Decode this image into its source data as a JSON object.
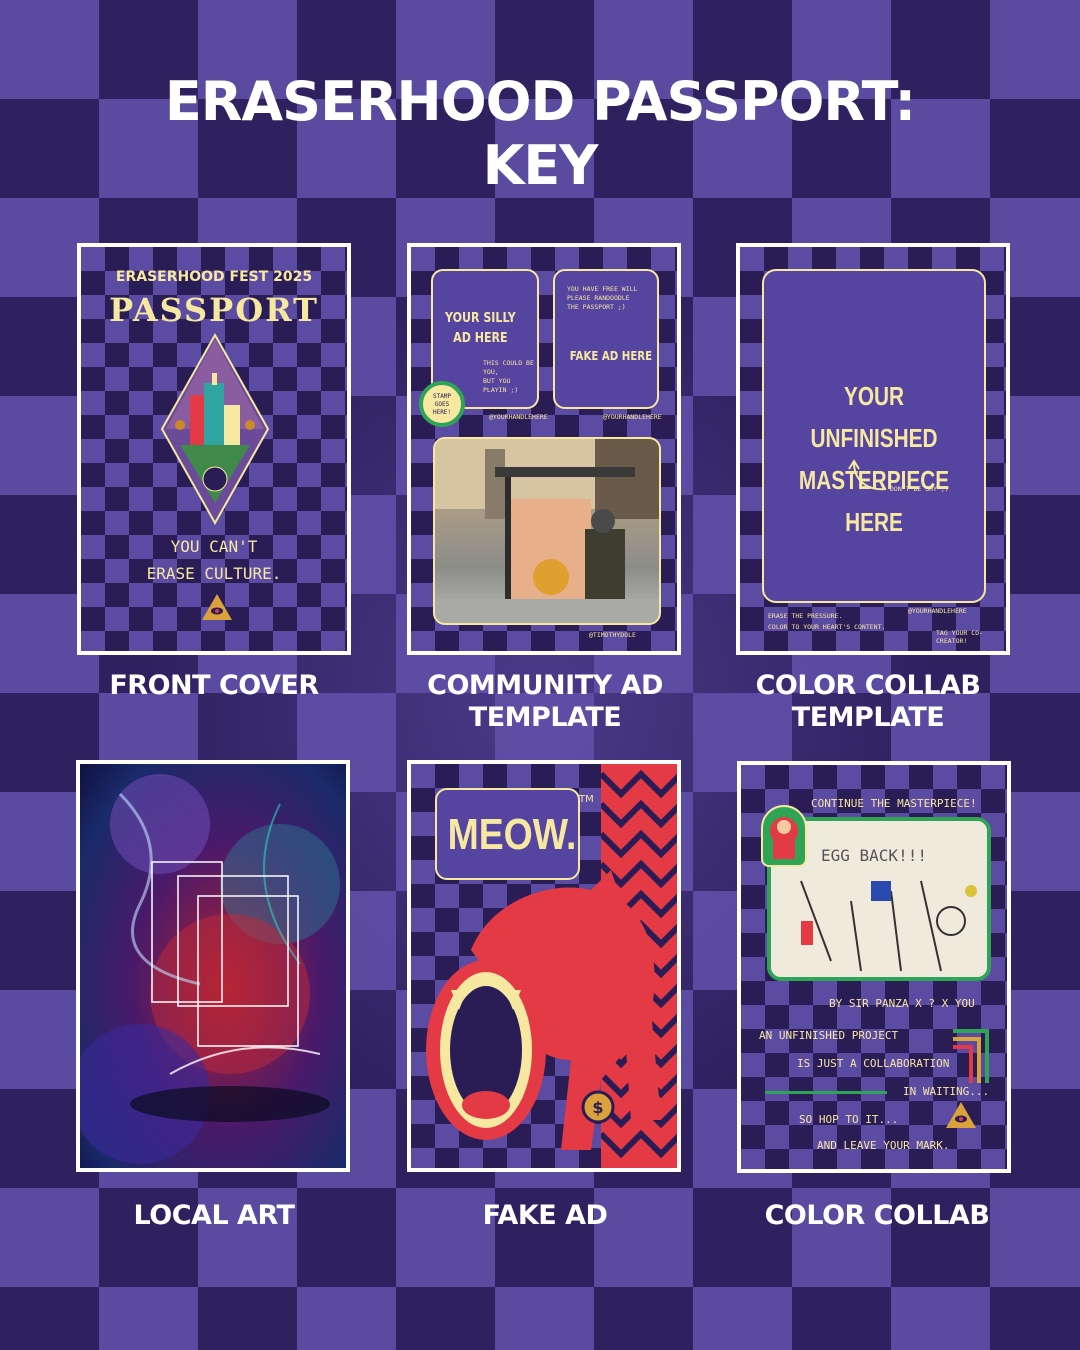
{
  "header": {
    "title_line1": "ERASERHOOD PASSPORT:",
    "title_line2": "KEY"
  },
  "cards": {
    "front_cover": {
      "caption": "FRONT COVER",
      "fest": "ERASERHOOD FEST 2025",
      "title": "PASSPORT",
      "slogan_line1": "YOU CAN'T",
      "slogan_line2": "ERASE CULTURE."
    },
    "community_ad": {
      "caption_line1": "COMMUNITY AD",
      "caption_line2": "TEMPLATE",
      "silly_line1": "YOUR SILLY",
      "silly_line2": "AD HERE",
      "note1_line1": "THIS COULD BE YOU,",
      "note1_line2": "BUT YOU PLAYIN ;)",
      "stamp_line1": "STAMP",
      "stamp_line2": "GOES",
      "stamp_line3": "HERE!",
      "handle1": "@YOURHANDLEHERE",
      "note2_line1": "YOU HAVE FREE WILL",
      "note2_line2": "PLEASE RANDOODLE",
      "note2_line3": "THE PASSPORT ;)",
      "fake_ad": "FAKE AD HERE",
      "handle2": "@YOURHANDLEHERE",
      "credit": "@TIMOTHYDOLE"
    },
    "color_collab_template": {
      "caption_line1": "COLOR COLLAB",
      "caption_line2": "TEMPLATE",
      "master_line1": "YOUR UNFINISHED",
      "master_line2": "MASTERPIECE HERE",
      "shy": "DON'T BE SHY ;)",
      "erase_line1": "ERASE THE PRESSURE.",
      "erase_line2": "COLOR TO YOUR HEART'S CONTENT.",
      "handle": "@YOURHANDLEHERE",
      "tag": "TAG YOUR CO-CREATOR!"
    },
    "local_art": {
      "caption": "LOCAL ART"
    },
    "fake_ad": {
      "caption": "FAKE AD",
      "brand": "MEOW.",
      "tm": "TM"
    },
    "color_collab": {
      "caption": "COLOR COLLAB",
      "continue": "CONTINUE THE MASTERPIECE!",
      "by": "BY SIR PANZA X ? X YOU",
      "line1": "AN UNFINISHED PROJECT",
      "line2": "IS JUST A COLLABORATION",
      "line3": "IN WAITING...",
      "line4": "SO HOP TO IT...",
      "line5": "AND LEAVE YOUR MARK."
    }
  },
  "colors": {
    "purple_dark": "#2a1d55",
    "purple_light": "#5b4ba3",
    "cream": "#f6e8a0",
    "red": "#e43a45",
    "white": "#ffffff"
  }
}
